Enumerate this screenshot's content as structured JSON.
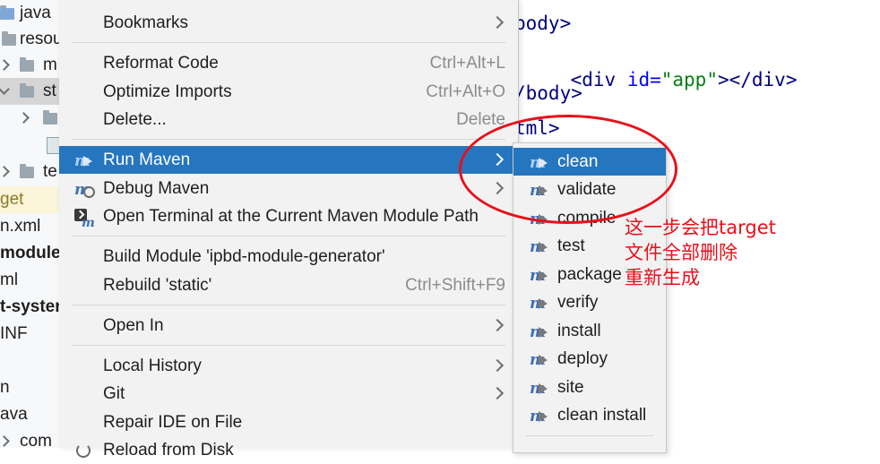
{
  "tree": {
    "rows": [
      "java",
      "resou",
      "m",
      "st",
      "",
      "",
      "te",
      "get",
      "n.xml",
      "module-",
      "ml",
      "t-syster",
      "INF",
      "",
      "n",
      "ava",
      "com"
    ]
  },
  "editor": {
    "line1": "body>",
    "line2_open": "<div",
    "line2_attr": "id=",
    "line2_val": "\"app\"",
    "line2_close": "></div>",
    "line3": "/body>",
    "line4": "tml>"
  },
  "menu": {
    "bookmarks": "Bookmarks",
    "reformat_code": {
      "label": "Reformat Code",
      "shortcut": "Ctrl+Alt+L"
    },
    "optimize_imports": {
      "label": "Optimize Imports",
      "shortcut": "Ctrl+Alt+O"
    },
    "delete": {
      "label": "Delete...",
      "shortcut": "Delete"
    },
    "run_maven": "Run Maven",
    "debug_maven": "Debug Maven",
    "open_terminal": "Open Terminal at the Current Maven Module Path",
    "build_module": "Build Module 'ipbd-module-generator'",
    "rebuild": {
      "label": "Rebuild 'static'",
      "shortcut": "Ctrl+Shift+F9"
    },
    "open_in": "Open In",
    "local_history": "Local History",
    "git": "Git",
    "repair_ide": "Repair IDE on File",
    "reload_from_disk": "Reload from Disk"
  },
  "submenu": {
    "items": [
      "clean",
      "validate",
      "compile",
      "test",
      "package",
      "verify",
      "install",
      "deploy",
      "site",
      "clean install"
    ]
  },
  "annotation": {
    "line1": "这一步会把target",
    "line2": "文件全部删除",
    "line3": "重新生成",
    "color": "#e8101a"
  },
  "colors": {
    "highlight": "#2675bf",
    "menu_bg": "#f2f2f2"
  }
}
